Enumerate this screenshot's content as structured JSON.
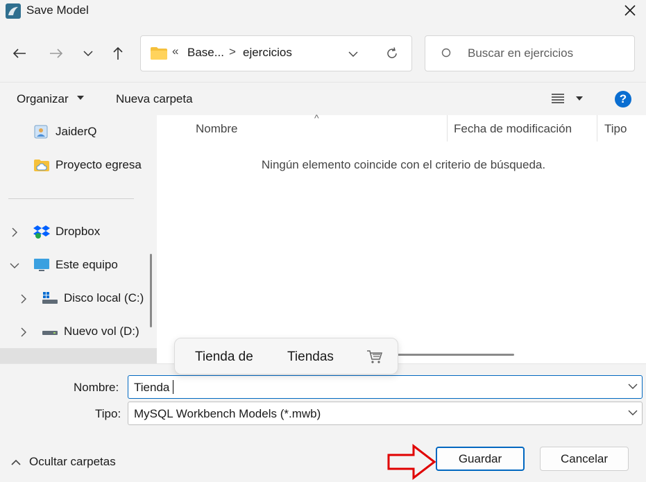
{
  "window": {
    "title": "Save Model",
    "close_icon": "close-icon"
  },
  "nav": {
    "address": {
      "overflow": "«",
      "parent": "Base...",
      "separator": ">",
      "current": "ejercicios"
    },
    "search": {
      "placeholder": "Buscar en ejercicios"
    }
  },
  "toolbar": {
    "organize": "Organizar",
    "new_folder": "Nueva carpeta"
  },
  "sidebar": {
    "items": [
      {
        "label": "JaiderQ",
        "icon": "user-folder-icon"
      },
      {
        "label": "Proyecto egresa",
        "icon": "cloud-folder-icon"
      },
      {
        "label": "Dropbox",
        "icon": "dropbox-icon"
      },
      {
        "label": "Este equipo",
        "icon": "computer-icon"
      },
      {
        "label": "Disco local (C:)",
        "icon": "drive-icon"
      },
      {
        "label": "Nuevo vol (D:)",
        "icon": "drive-icon"
      }
    ]
  },
  "content": {
    "columns": [
      "Nombre",
      "Fecha de modificación",
      "Tipo"
    ],
    "empty_message": "Ningún elemento coincide con el criterio de búsqueda."
  },
  "autocomplete": {
    "items": [
      "Tienda de",
      "Tiendas"
    ],
    "cart_icon": "shopping-cart-icon"
  },
  "form": {
    "name_label": "Nombre:",
    "name_value": "Tienda",
    "type_label": "Tipo:",
    "type_value": "MySQL Workbench Models (*.mwb)"
  },
  "footer": {
    "hide_folders": "Ocultar carpetas",
    "save": "Guardar",
    "cancel": "Cancelar"
  },
  "colors": {
    "accent": "#0067c0",
    "help_blue": "#0a6ed1",
    "arrow_red": "#e00000"
  }
}
